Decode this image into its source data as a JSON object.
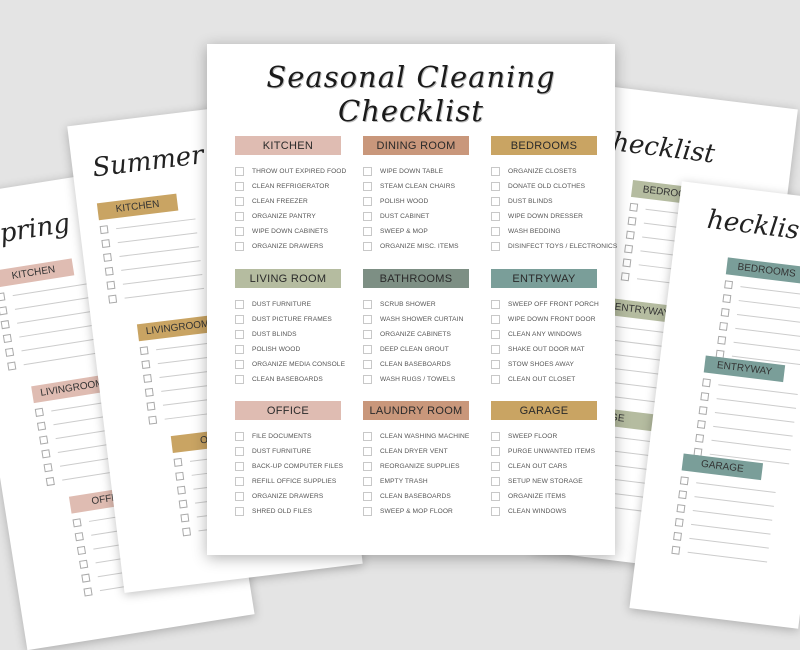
{
  "background_pages": [
    {
      "title": "Spring",
      "sections": [
        "KITCHEN",
        "LIVINGROOM",
        "OFFICE"
      ],
      "color": [
        "#dfbcb2",
        "#dfbcb2",
        "#dfbcb2"
      ]
    },
    {
      "title": "Summer C",
      "sections": [
        "KITCHEN",
        "LIVINGROOM",
        "OFFI"
      ],
      "color": [
        "#c9a463",
        "#c9a463",
        "#c9a463"
      ]
    },
    {
      "title": "hecklist",
      "sections": [
        "BEDROOMS",
        "ENTRYWAY",
        "AGE"
      ],
      "color": [
        "#b5bca0",
        "#b5bca0",
        "#b5bca0"
      ]
    },
    {
      "title": "hecklist",
      "sections": [
        "BEDROOMS",
        "ENTRYWAY",
        "GARAGE"
      ],
      "color": [
        "#7a9e99",
        "#7a9e99",
        "#7a9e99"
      ]
    }
  ],
  "main": {
    "title": "Seasonal Cleaning Checklist",
    "sections": [
      {
        "name": "KITCHEN",
        "color": "#dfbcb2",
        "items": [
          "THROW OUT EXPIRED FOOD",
          "CLEAN REFRIGERATOR",
          "CLEAN FREEZER",
          "ORGANIZE PANTRY",
          "WIPE DOWN CABINETS",
          "ORGANIZE DRAWERS"
        ]
      },
      {
        "name": "DINING ROOM",
        "color": "#c9977b",
        "items": [
          "WIPE DOWN TABLE",
          "STEAM CLEAN CHAIRS",
          "POLISH WOOD",
          "DUST CABINET",
          "SWEEP & MOP",
          "ORGANIZE MISC. ITEMS"
        ]
      },
      {
        "name": "BEDROOMS",
        "color": "#c9a463",
        "items": [
          "ORGANIZE CLOSETS",
          "DONATE OLD CLOTHES",
          "DUST BLINDS",
          "WIPE DOWN DRESSER",
          "WASH BEDDING",
          "DISINFECT TOYS / ELECTRONICS"
        ]
      },
      {
        "name": "LIVING ROOM",
        "color": "#b5bca0",
        "items": [
          "DUST FURNITURE",
          "DUST PICTURE FRAMES",
          "DUST BLINDS",
          "POLISH WOOD",
          "ORGANIZE MEDIA CONSOLE",
          "CLEAN BASEBOARDS"
        ]
      },
      {
        "name": "BATHROOMS",
        "color": "#7d8f84",
        "items": [
          "SCRUB SHOWER",
          "WASH SHOWER CURTAIN",
          "ORGANIZE CABINETS",
          "DEEP CLEAN GROUT",
          "CLEAN BASEBOARDS",
          "WASH RUGS / TOWELS"
        ]
      },
      {
        "name": "ENTRYWAY",
        "color": "#7a9e99",
        "items": [
          "SWEEP OFF FRONT PORCH",
          "WIPE DOWN FRONT DOOR",
          "CLEAN ANY WINDOWS",
          "SHAKE OUT DOOR MAT",
          "STOW SHOES AWAY",
          "CLEAN OUT CLOSET"
        ]
      },
      {
        "name": "OFFICE",
        "color": "#dfbcb2",
        "items": [
          "FILE DOCUMENTS",
          "DUST FURNITURE",
          "BACK-UP COMPUTER FILES",
          "REFILL OFFICE SUPPLIES",
          "ORGANIZE DRAWERS",
          "SHRED OLD FILES"
        ]
      },
      {
        "name": "LAUNDRY ROOM",
        "color": "#c9977b",
        "items": [
          "CLEAN WASHING MACHINE",
          "CLEAN DRYER VENT",
          "REORGANIZE SUPPLIES",
          "EMPTY TRASH",
          "CLEAN BASEBOARDS",
          "SWEEP & MOP FLOOR"
        ]
      },
      {
        "name": "GARAGE",
        "color": "#c9a463",
        "items": [
          "SWEEP FLOOR",
          "PURGE UNWANTED ITEMS",
          "CLEAN OUT CARS",
          "SETUP NEW STORAGE",
          "ORGANIZE ITEMS",
          "CLEAN WINDOWS"
        ]
      }
    ]
  }
}
